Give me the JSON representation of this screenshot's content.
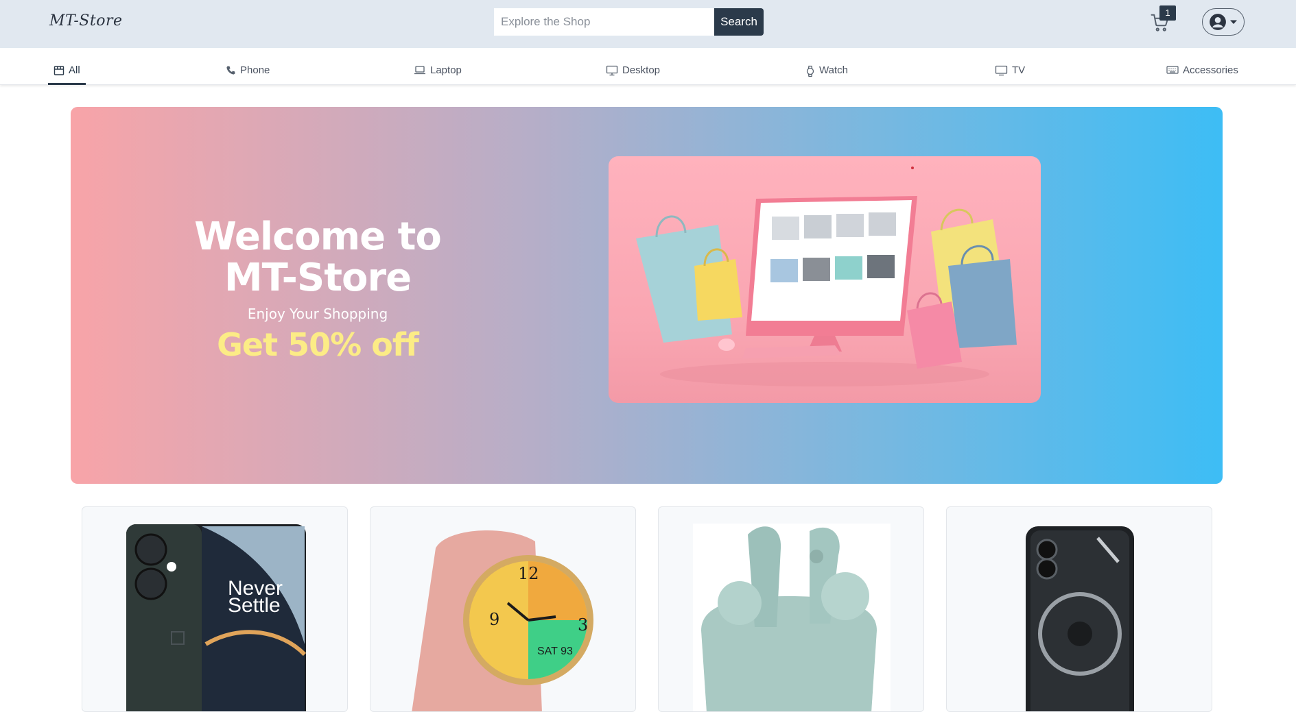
{
  "header": {
    "logo": "MT-Store",
    "search": {
      "placeholder": "Explore the Shop",
      "value": "",
      "button_label": "Search"
    },
    "cart": {
      "icon": "cart-icon",
      "count": "1"
    },
    "user_menu": {
      "icon": "user-circle-icon",
      "caret": "caret-down-icon"
    }
  },
  "categories": [
    {
      "label": "All",
      "icon": "store-icon",
      "active": true
    },
    {
      "label": "Phone",
      "icon": "phone-icon",
      "active": false
    },
    {
      "label": "Laptop",
      "icon": "laptop-icon",
      "active": false
    },
    {
      "label": "Desktop",
      "icon": "desktop-icon",
      "active": false
    },
    {
      "label": "Watch",
      "icon": "watch-icon",
      "active": false
    },
    {
      "label": "TV",
      "icon": "tv-icon",
      "active": false
    },
    {
      "label": "Accessories",
      "icon": "keyboard-icon",
      "active": false
    }
  ],
  "hero": {
    "title_line1": "Welcome to",
    "title_line2": "MT-Store",
    "subtitle": "Enjoy Your Shopping",
    "offer": "Get 50% off",
    "image_alt": "shopping-bags-computer-illustration"
  },
  "products": [
    {
      "image": "smartphone-never-settle",
      "image_text": "Never Settle"
    },
    {
      "image": "smartwatch-pink-strap",
      "image_text": "SAT 93"
    },
    {
      "image": "wireless-earbuds-mint"
    },
    {
      "image": "smartphone-transparent-back"
    }
  ],
  "colors": {
    "header_bg": "#e1e8f0",
    "primary": "#2b3a4a",
    "hero_gradient_start": "#f8a4a8",
    "hero_gradient_end": "#3dbdf5",
    "offer_text": "#fcec86"
  }
}
